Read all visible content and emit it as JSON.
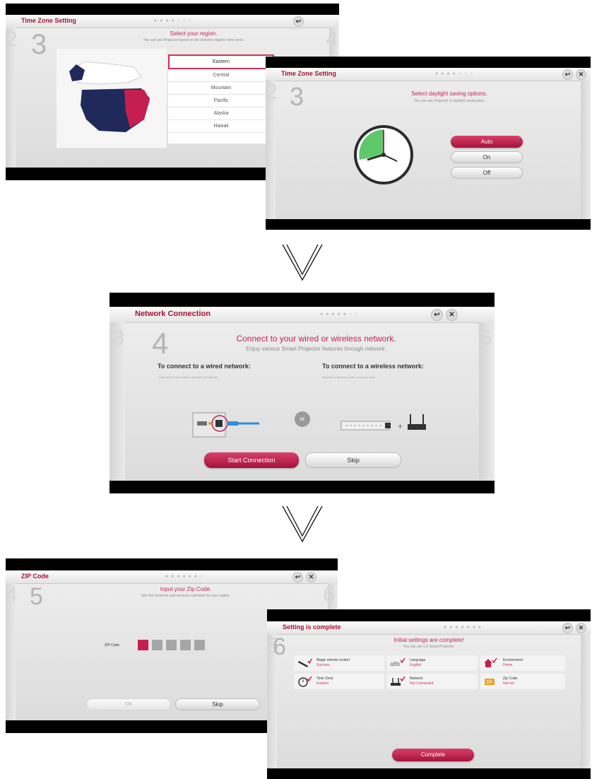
{
  "screen1": {
    "title": "Time Zone Setting",
    "step": "3",
    "prev_step": "2",
    "next_step": "4",
    "heading": "Select your region.",
    "subheading": "You can use Projector based on the selected region's time zone.",
    "regions": [
      "Eastern",
      "Central",
      "Mountain",
      "Pacific",
      "Alaska",
      "Hawaii"
    ],
    "selected_region": "Eastern",
    "back_icon": "↩"
  },
  "screen2": {
    "title": "Time Zone Setting",
    "step": "3",
    "prev_step": "2",
    "heading": "Select daylight saving options.",
    "subheading": "You can use Projector in daylight saving time.",
    "options": [
      "Auto",
      "On",
      "Off"
    ],
    "selected_option": "Auto",
    "back_icon": "↩",
    "close_icon": "✕"
  },
  "screen3": {
    "title": "Network Connection",
    "step": "4",
    "prev_step": "3",
    "next_step": "5",
    "heading": "Connect to your wired or wireless network.",
    "subheading": "Enjoy various Smart Projector features through network.",
    "wired_title": "To connect to a wired network:",
    "wired_desc": "Connect LG LAN cable to the back of Projector.",
    "wireless_title": "To connect to a wireless network:",
    "wireless_desc": "Requires a wireless router or access point.",
    "or_label": "or",
    "start_button": "Start Connection",
    "skip_button": "Skip",
    "back_icon": "↩",
    "close_icon": "✕"
  },
  "screen4": {
    "title": "ZIP Code",
    "step": "5",
    "prev_step": "4",
    "next_step": "6",
    "heading": "Input your Zip Code.",
    "subheading": "See the channels and services optimized for your region.",
    "zip_label": "ZIP Code",
    "ok_button": "OK",
    "skip_button": "Skip",
    "back_icon": "↩",
    "close_icon": "✕"
  },
  "screen5": {
    "title": "Setting is complete",
    "step": "6",
    "prev_step": "5",
    "heading": "Initial settings are complete!",
    "subheading": "You can use LG Smart Projector.",
    "items": [
      {
        "label": "Magic remote control",
        "status": "Success"
      },
      {
        "label": "Language",
        "status": "English"
      },
      {
        "label": "Environment",
        "status": "Home"
      },
      {
        "label": "Time Zone",
        "status": "Eastern"
      },
      {
        "label": "Network",
        "status": "Not Connected"
      },
      {
        "label": "Zip Code",
        "status": "Not set"
      }
    ],
    "complete_button": "Complete",
    "back_icon": "↩",
    "close_icon": "✕"
  },
  "colors": {
    "accent": "#c2255a",
    "bezel": "#000000",
    "panel": "#e6e6e6"
  }
}
